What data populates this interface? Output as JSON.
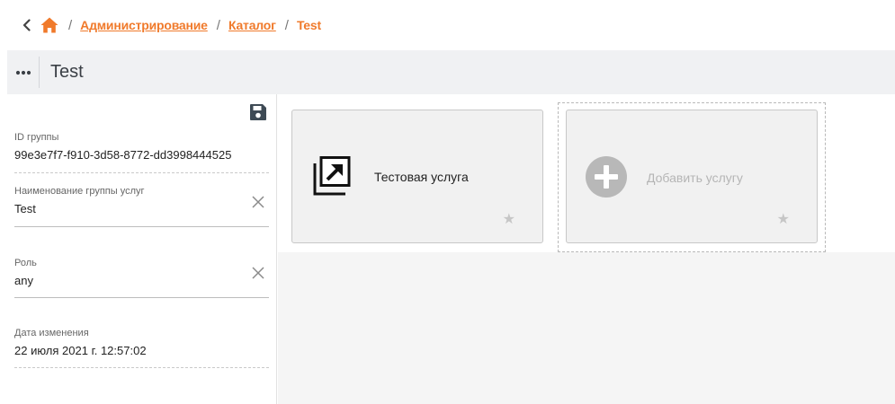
{
  "breadcrumb": {
    "back_icon": "chevron-left-icon",
    "home_icon": "home-icon",
    "home_color": "#f07a2b",
    "separator": "/",
    "items": [
      "Администрирование",
      "Каталог"
    ],
    "current": "Test"
  },
  "header": {
    "menu_icon": "more-horizontal-icon",
    "title": "Test"
  },
  "form": {
    "save_icon": "floppy-disk-icon",
    "fields": [
      {
        "label": "ID группы",
        "value": "99e3e7f7-f910-3d58-8772-dd3998444525"
      },
      {
        "label": "Наименование группы услуг",
        "value": "Test"
      },
      {
        "label": "Роль",
        "value": "any"
      },
      {
        "label": "Дата изменения",
        "value": "22 июля 2021 г. 12:57:02"
      }
    ]
  },
  "cards": [
    {
      "title": "Тестовая услуга",
      "icon": "open-external-icon",
      "star_icon": "star-icon",
      "star": "★"
    },
    {
      "title": "Добавить услугу",
      "icon": "add-circle-icon",
      "star_icon": "star-icon",
      "star": "★"
    }
  ],
  "colors": {
    "accent": "#f07a2b",
    "titlebar_bg": "#f0f1f3"
  }
}
